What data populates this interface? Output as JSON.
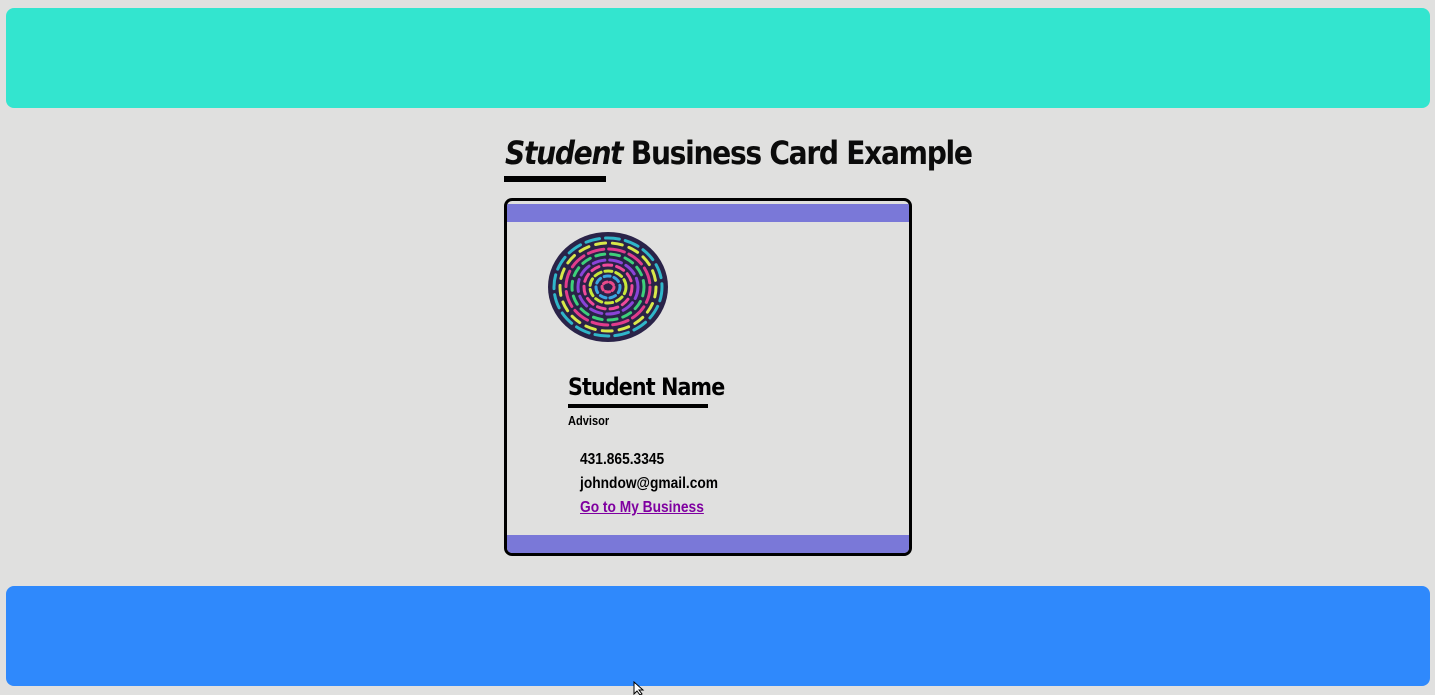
{
  "page": {
    "title_emphasis": "Student",
    "title_rest": " Business Card Example"
  },
  "card": {
    "name": "Student Name",
    "role": "Advisor",
    "phone": "431.865.3345",
    "email": "johndow@gmail.com",
    "link_label": "Go to My Business",
    "avatar_icon": "spiral-art-icon"
  },
  "colors": {
    "top_banner": "#33e5cf",
    "bottom_banner": "#2f89fc",
    "card_bar": "#7a78d8",
    "background": "#e0e0df",
    "link": "#7f00a0"
  }
}
